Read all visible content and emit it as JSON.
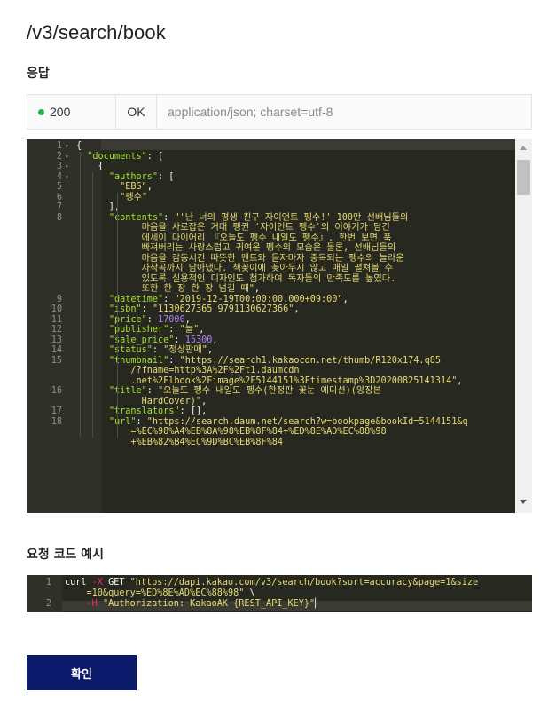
{
  "endpoint": "/v3/search/book",
  "response": {
    "title": "응답",
    "status_code": "200",
    "status_text": "OK",
    "content_type": "application/json; charset=utf-8",
    "status_color": "#25b34b"
  },
  "json_lines": [
    {
      "ln": "1",
      "fold": "▾",
      "parts": [
        [
          "p",
          "{"
        ]
      ]
    },
    {
      "ln": "2",
      "fold": "▾",
      "parts": [
        [
          "p",
          "  "
        ],
        [
          "k",
          "\"documents\""
        ],
        [
          "p",
          ": ["
        ]
      ]
    },
    {
      "ln": "3",
      "fold": "▾",
      "parts": [
        [
          "p",
          "    {"
        ]
      ]
    },
    {
      "ln": "4",
      "fold": "▾",
      "parts": [
        [
          "p",
          "      "
        ],
        [
          "k",
          "\"authors\""
        ],
        [
          "p",
          ": ["
        ]
      ]
    },
    {
      "ln": "5",
      "fold": "",
      "parts": [
        [
          "p",
          "        "
        ],
        [
          "s",
          "\"EBS\""
        ],
        [
          "p",
          ","
        ]
      ]
    },
    {
      "ln": "6",
      "fold": "",
      "parts": [
        [
          "p",
          "        "
        ],
        [
          "s",
          "\"펭수\""
        ]
      ]
    },
    {
      "ln": "7",
      "fold": "",
      "parts": [
        [
          "p",
          "      ],"
        ]
      ]
    },
    {
      "ln": "8",
      "fold": "",
      "parts": [
        [
          "p",
          "      "
        ],
        [
          "k",
          "\"contents\""
        ],
        [
          "p",
          ": "
        ],
        [
          "s",
          "\"'난 너의 평생 친구 자이언트 펭수!' 100만 선배님들의"
        ]
      ]
    },
    {
      "ln": "",
      "fold": "",
      "parts": [
        [
          "s",
          "            마음을 사로잡은 거대 펭귄 '자이언트 펭수'의 이야기가 담긴"
        ]
      ]
    },
    {
      "ln": "",
      "fold": "",
      "parts": [
        [
          "s",
          "            에세이 다이어리 『오늘도 펭수 내일도 펭수』. 한번 보면 푹"
        ]
      ]
    },
    {
      "ln": "",
      "fold": "",
      "parts": [
        [
          "s",
          "            빠져버리는 사랑스럽고 귀여운 펭수의 모습은 물론, 선배님들의"
        ]
      ]
    },
    {
      "ln": "",
      "fold": "",
      "parts": [
        [
          "s",
          "            마음을 감동시킨 따뜻한 멘트와 듣자마자 중독되는 펭수의 놀라운"
        ]
      ]
    },
    {
      "ln": "",
      "fold": "",
      "parts": [
        [
          "s",
          "            자작곡까지 담아냈다. 책꽂이에 꽂아두지 않고 매일 펼쳐볼 수"
        ]
      ]
    },
    {
      "ln": "",
      "fold": "",
      "parts": [
        [
          "s",
          "            있도록 실용적인 디자인도 첨가하여 독자들의 만족도를 높였다."
        ]
      ]
    },
    {
      "ln": "",
      "fold": "",
      "parts": [
        [
          "s",
          "            또한 한 장 한 장 넘길 때\""
        ],
        [
          "p",
          ","
        ]
      ]
    },
    {
      "ln": "9",
      "fold": "",
      "parts": [
        [
          "p",
          "      "
        ],
        [
          "k",
          "\"datetime\""
        ],
        [
          "p",
          ": "
        ],
        [
          "s",
          "\"2019-12-19T00:00:00.000+09:00\""
        ],
        [
          "p",
          ","
        ]
      ]
    },
    {
      "ln": "10",
      "fold": "",
      "parts": [
        [
          "p",
          "      "
        ],
        [
          "k",
          "\"isbn\""
        ],
        [
          "p",
          ": "
        ],
        [
          "s",
          "\"1130627365 9791130627366\""
        ],
        [
          "p",
          ","
        ]
      ]
    },
    {
      "ln": "11",
      "fold": "",
      "parts": [
        [
          "p",
          "      "
        ],
        [
          "k",
          "\"price\""
        ],
        [
          "p",
          ": "
        ],
        [
          "n",
          "17000"
        ],
        [
          "p",
          ","
        ]
      ]
    },
    {
      "ln": "12",
      "fold": "",
      "parts": [
        [
          "p",
          "      "
        ],
        [
          "k",
          "\"publisher\""
        ],
        [
          "p",
          ": "
        ],
        [
          "s",
          "\"놀\""
        ],
        [
          "p",
          ","
        ]
      ]
    },
    {
      "ln": "13",
      "fold": "",
      "parts": [
        [
          "p",
          "      "
        ],
        [
          "k",
          "\"sale_price\""
        ],
        [
          "p",
          ": "
        ],
        [
          "n",
          "15300"
        ],
        [
          "p",
          ","
        ]
      ]
    },
    {
      "ln": "14",
      "fold": "",
      "parts": [
        [
          "p",
          "      "
        ],
        [
          "k",
          "\"status\""
        ],
        [
          "p",
          ": "
        ],
        [
          "s",
          "\"정상판매\""
        ],
        [
          "p",
          ","
        ]
      ]
    },
    {
      "ln": "15",
      "fold": "",
      "parts": [
        [
          "p",
          "      "
        ],
        [
          "k",
          "\"thumbnail\""
        ],
        [
          "p",
          ": "
        ],
        [
          "s",
          "\"https://search1.kakaocdn.net/thumb/R120x174.q85"
        ]
      ]
    },
    {
      "ln": "",
      "fold": "",
      "parts": [
        [
          "s",
          "          /?fname=http%3A%2F%2Ft1.daumcdn"
        ]
      ]
    },
    {
      "ln": "",
      "fold": "",
      "parts": [
        [
          "s",
          "          .net%2Flbook%2Fimage%2F5144151%3Ftimestamp%3D20200825141314\""
        ],
        [
          "p",
          ","
        ]
      ]
    },
    {
      "ln": "16",
      "fold": "",
      "parts": [
        [
          "p",
          "      "
        ],
        [
          "k",
          "\"title\""
        ],
        [
          "p",
          ": "
        ],
        [
          "s",
          "\"오늘도 펭수 내일도 펭수(한정판 꽃눈 에디션)(양장본"
        ]
      ]
    },
    {
      "ln": "",
      "fold": "",
      "parts": [
        [
          "s",
          "            HardCover)\""
        ],
        [
          "p",
          ","
        ]
      ]
    },
    {
      "ln": "17",
      "fold": "",
      "parts": [
        [
          "p",
          "      "
        ],
        [
          "k",
          "\"translators\""
        ],
        [
          "p",
          ": [],"
        ]
      ]
    },
    {
      "ln": "18",
      "fold": "",
      "parts": [
        [
          "p",
          "      "
        ],
        [
          "k",
          "\"url\""
        ],
        [
          "p",
          ": "
        ],
        [
          "s",
          "\"https://search.daum.net/search?w=bookpage&bookId=5144151&q"
        ]
      ]
    },
    {
      "ln": "",
      "fold": "",
      "parts": [
        [
          "s",
          "          =%EC%98%A4%EB%8A%98%EB%8F%84+%ED%8E%AD%EC%88%98"
        ]
      ]
    },
    {
      "ln": "",
      "fold": "",
      "parts": [
        [
          "s",
          "          +%EB%82%B4%EC%9D%BC%EB%8F%84"
        ]
      ]
    }
  ],
  "request": {
    "title": "요청 코드 예시",
    "lines": [
      {
        "ln": "1",
        "parts": [
          [
            "w",
            "curl "
          ],
          [
            "o",
            "-X"
          ],
          [
            "w",
            " GET "
          ],
          [
            "s",
            "\"https://dapi.kakao.com/v3/search/book?sort=accuracy&page=1&size"
          ]
        ]
      },
      {
        "ln": "",
        "parts": [
          [
            "s",
            "    =10&query=%ED%8E%AD%EC%88%98\""
          ],
          [
            "w",
            " \\"
          ]
        ]
      },
      {
        "ln": "2",
        "parts": [
          [
            "w",
            "    "
          ],
          [
            "o",
            "-H"
          ],
          [
            "w",
            " "
          ],
          [
            "s",
            "\"Authorization: KakaoAK {REST_API_KEY}\""
          ],
          [
            "w",
            "▏"
          ]
        ]
      }
    ]
  },
  "confirm_label": "확인"
}
